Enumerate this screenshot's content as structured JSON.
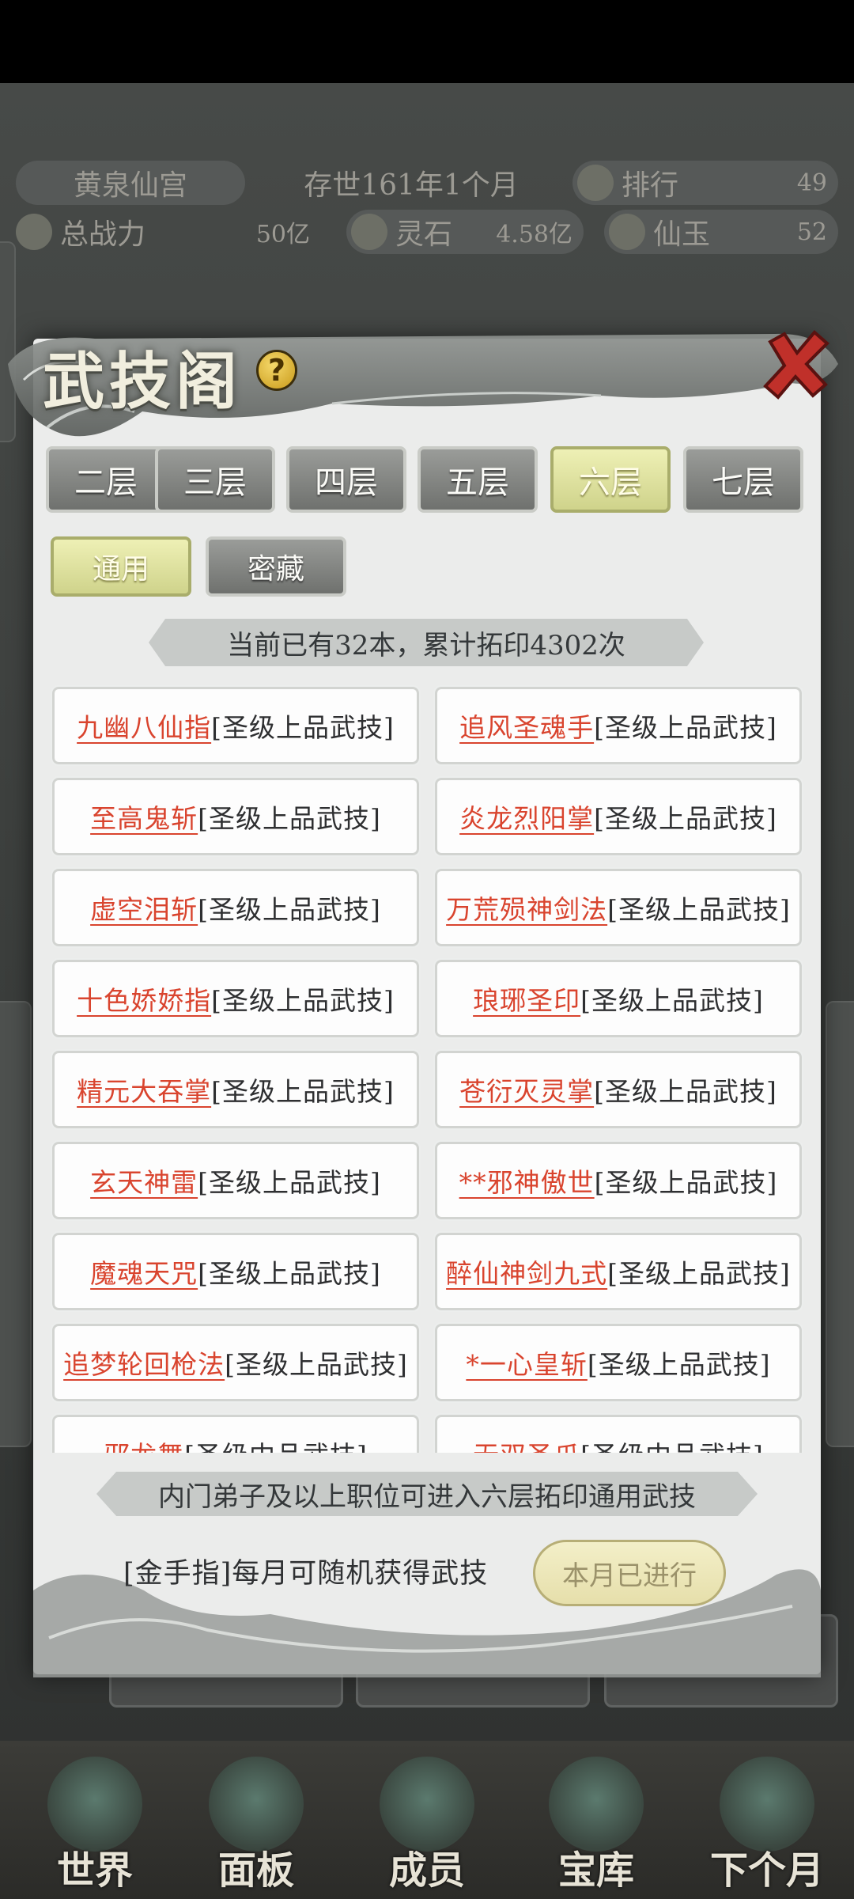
{
  "background": {
    "sect_name": "黄泉仙宫",
    "survival_time": "存世161年1个月",
    "rank_label": "排行",
    "rank_value": "49",
    "power_label": "总战力",
    "power_value": "50亿",
    "spirit_stone_label": "灵石",
    "spirit_stone_value": "4.58亿",
    "jade_label": "仙玉",
    "jade_value": "52",
    "nav": [
      "世界",
      "面板",
      "成员",
      "宝库",
      "下个月"
    ]
  },
  "modal": {
    "title": "武技阁",
    "floor_tabs": [
      "二层",
      "三层",
      "四层",
      "五层",
      "六层",
      "七层"
    ],
    "active_floor": "六层",
    "type_tabs": [
      "通用",
      "密藏"
    ],
    "active_type": "通用",
    "summary": "当前已有32本，累计拓印4302次",
    "skills": [
      {
        "name": "九幽八仙指",
        "grade": "[圣级上品武技]"
      },
      {
        "name": "追风圣魂手",
        "grade": "[圣级上品武技]"
      },
      {
        "name": "至高鬼斩",
        "grade": "[圣级上品武技]"
      },
      {
        "name": "炎龙烈阳掌",
        "grade": "[圣级上品武技]"
      },
      {
        "name": "虚空泪斩",
        "grade": "[圣级上品武技]"
      },
      {
        "name": "万荒殒神剑法",
        "grade": "[圣级上品武技]"
      },
      {
        "name": "十色娇娇指",
        "grade": "[圣级上品武技]"
      },
      {
        "name": "琅琊圣印",
        "grade": "[圣级上品武技]"
      },
      {
        "name": "精元大吞掌",
        "grade": "[圣级上品武技]"
      },
      {
        "name": "苍衍灭灵掌",
        "grade": "[圣级上品武技]"
      },
      {
        "name": "玄天神雷",
        "grade": "[圣级上品武技]"
      },
      {
        "name": "**邪神傲世",
        "grade": "[圣级上品武技]"
      },
      {
        "name": "魔魂天咒",
        "grade": "[圣级上品武技]"
      },
      {
        "name": "醉仙神剑九式",
        "grade": "[圣级上品武技]"
      },
      {
        "name": "追梦轮回枪法",
        "grade": "[圣级上品武技]"
      },
      {
        "name": "*一心皇斩",
        "grade": "[圣级上品武技]"
      },
      {
        "name": "邪龙舞",
        "grade": "[圣级中品武技]"
      },
      {
        "name": "无双圣爪",
        "grade": "[圣级中品武技]"
      }
    ],
    "requirement": "内门弟子及以上职位可进入六层拓印通用武技",
    "goldfinger_text": "[金手指]每月可随机获得武技",
    "done_button": "本月已进行"
  },
  "colors": {
    "skill_name": "#d9442e",
    "active_tab": "#cfd38b",
    "modal_bg": "#ebeceb"
  }
}
